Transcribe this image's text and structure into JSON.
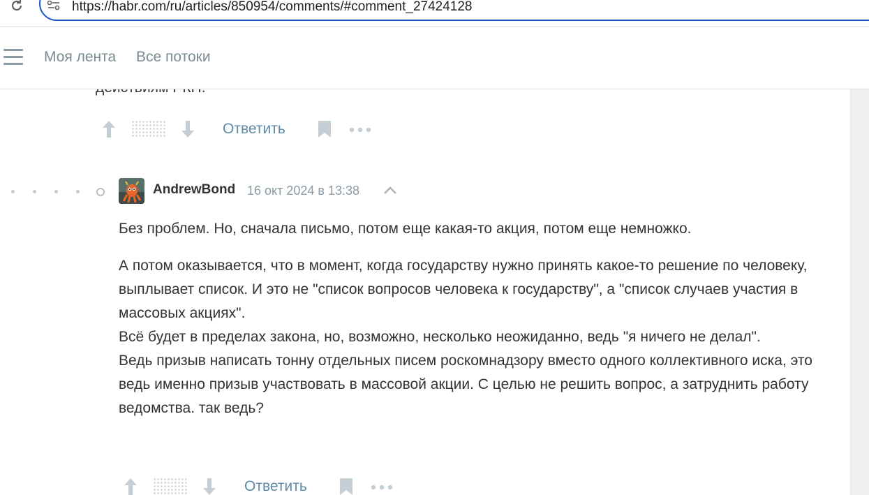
{
  "browser": {
    "url": "https://habr.com/ru/articles/850954/comments/#comment_27424128"
  },
  "nav": {
    "my_feed": "Моя лента",
    "all_flows": "Все потоки"
  },
  "previous_comment": {
    "cut_text": "действиям РКН.",
    "reply_label": "Ответить"
  },
  "comment": {
    "author": "AndrewBond",
    "timestamp": "16 окт 2024 в 13:38",
    "paragraphs": [
      "Без проблем. Но, сначала письмо, потом еще какая-то акция, потом еще немножко.",
      "А потом оказывается, что в момент, когда государству нужно принять какое-то решение по человеку, выплывает список. И это не \"список вопросов человека к государству\", а \"список случаев участия в массовых акциях\".",
      "Всё будет в пределах закона, но, возможно, несколько неожиданно, ведь \"я ничего не делал\".",
      "Ведь призыв написать тонну отдельных писем роскомнадзору вместо одного коллективного иска, это ведь именно призыв участвовать в массовой акции. С целью не решить вопрос, а затруднить работу ведомства. так ведь?"
    ],
    "reply_label": "Ответить"
  },
  "icons": {
    "reload": "reload-icon",
    "site_info": "site-info-icon",
    "menu": "hamburger-icon",
    "vote_up": "arrow-up-icon",
    "vote_down": "arrow-down-icon",
    "bookmark": "bookmark-icon",
    "more": "more-dots-icon",
    "collapse": "chevron-up-icon"
  },
  "colors": {
    "accent_url_border": "#1a56c7",
    "link": "#5e8aa8",
    "muted": "#8a9aa4",
    "icon": "#c3ced5"
  }
}
